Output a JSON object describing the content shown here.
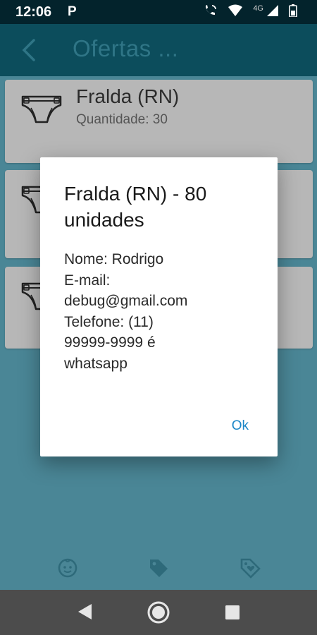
{
  "status_bar": {
    "time": "12:06",
    "notification": "P",
    "network": "4G"
  },
  "app_bar": {
    "title": "Ofertas ..."
  },
  "cards": [
    {
      "title": "Fralda (RN)",
      "subtitle": "Quantidade: 30",
      "icon": "diaper-icon"
    },
    {
      "title": "",
      "subtitle": "",
      "icon": "diaper-icon"
    },
    {
      "title": "",
      "subtitle": "",
      "icon": "diaper-icon"
    }
  ],
  "dialog": {
    "title": "Fralda (RN) - 80 unidades",
    "body": "Nome: Rodrigo\nE-mail:\ndebug@gmail.com\nTelefone: (11)\n99999-9999 é\nwhatsapp",
    "ok_label": "Ok"
  },
  "bottom_nav": {
    "icons": [
      "baby-face-icon",
      "tag-icon",
      "tag-heart-icon"
    ]
  },
  "colors": {
    "accent": "#1a86c7",
    "app_bar": "#0c4d5c",
    "status_bar": "#03232c"
  }
}
